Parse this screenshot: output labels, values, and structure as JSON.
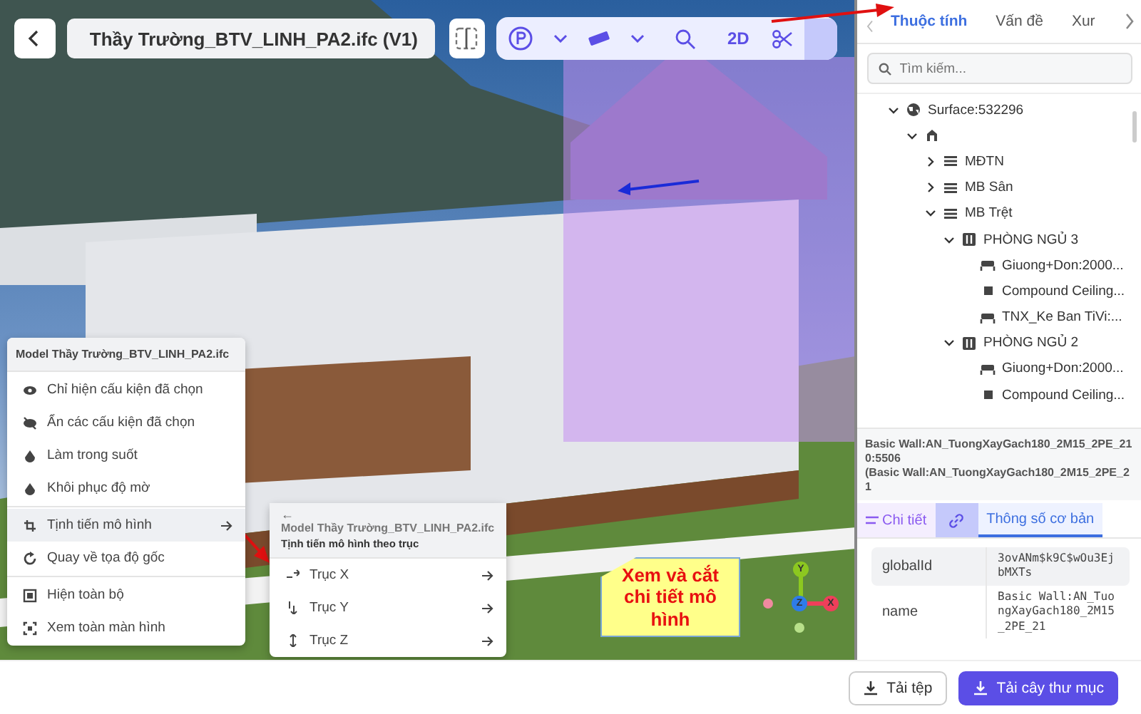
{
  "header": {
    "file_name": "Thầy Trường_BTV_LINH_PA2.ifc (V1)"
  },
  "toolbar": [
    {
      "kind": "pin",
      "selected": false
    },
    {
      "kind": "caret",
      "selected": false
    },
    {
      "kind": "ruler",
      "selected": false
    },
    {
      "kind": "caret",
      "selected": false
    },
    {
      "kind": "search",
      "selected": false
    },
    {
      "kind": "text",
      "label": "2D",
      "selected": false
    },
    {
      "kind": "scissors",
      "selected": false
    },
    {
      "kind": "tree",
      "selected": true
    }
  ],
  "context_menu": {
    "title": "Model Thầy Trường_BTV_LINH_PA2.ifc",
    "sections": [
      [
        {
          "kind": "eye",
          "label": "Chỉ hiện cấu kiện đã chọn",
          "selected": false,
          "submenu": false
        },
        {
          "kind": "eye-off",
          "label": "Ẩn các cấu kiện đã chọn",
          "selected": false,
          "submenu": false
        },
        {
          "kind": "drop",
          "label": "Làm trong suốt",
          "selected": false,
          "submenu": false
        },
        {
          "kind": "drop",
          "label": "Khôi phục độ mờ",
          "selected": false,
          "submenu": false
        }
      ],
      [
        {
          "kind": "move",
          "label": "Tịnh tiến mô hình",
          "selected": true,
          "submenu": true
        },
        {
          "kind": "rotate",
          "label": "Quay về tọa độ gốc",
          "selected": false,
          "submenu": false
        }
      ],
      [
        {
          "kind": "square",
          "label": "Hiện toàn bộ",
          "selected": false,
          "submenu": false
        },
        {
          "kind": "fullscreen",
          "label": "Xem toàn màn hình",
          "selected": false,
          "submenu": false
        }
      ]
    ]
  },
  "submenu": {
    "back": "←",
    "title": "Model Thầy Trường_BTV_LINH_PA2.ifc",
    "subtitle": "Tịnh tiến mô hình theo trục",
    "items": [
      {
        "kind": "x",
        "label": "Trục X"
      },
      {
        "kind": "y",
        "label": "Trục Y"
      },
      {
        "kind": "z",
        "label": "Trục Z"
      }
    ]
  },
  "callout": {
    "text": "Xem và cắt chi tiết mô hình"
  },
  "axis_gizmo": {
    "y": "Y",
    "z": "Z",
    "x": "X"
  },
  "panel": {
    "tabs": [
      {
        "label": "Thuộc tính",
        "selected": true
      },
      {
        "label": "Vấn đề",
        "selected": false
      },
      {
        "label": "Xur",
        "selected": false
      }
    ],
    "search": {
      "placeholder": "Tìm kiếm..."
    },
    "tree": [
      {
        "kind": "globe",
        "label": "Surface:532296",
        "expanded": true,
        "children": [
          {
            "kind": "building",
            "expanded": true,
            "children": [
              {
                "kind": "level",
                "label": "MĐTN",
                "expanded": false
              },
              {
                "kind": "level",
                "label": "MB Sân",
                "expanded": false
              },
              {
                "kind": "level",
                "label": "MB Trệt",
                "expanded": true,
                "children": [
                  {
                    "kind": "room",
                    "label": "PHÒNG NGỦ 3",
                    "expanded": true,
                    "children": [
                      {
                        "kind": "furniture",
                        "label": "Giuong+Don:2000..."
                      },
                      {
                        "kind": "element",
                        "label": "Compound Ceiling..."
                      },
                      {
                        "kind": "furniture",
                        "label": "TNX_Ke Ban TiVi:..."
                      }
                    ]
                  },
                  {
                    "kind": "room",
                    "label": "PHÒNG NGỦ 2",
                    "expanded": true,
                    "children": [
                      {
                        "kind": "furniture",
                        "label": "Giuong+Don:2000..."
                      },
                      {
                        "kind": "element",
                        "label": "Compound Ceiling..."
                      }
                    ]
                  }
                ]
              }
            ]
          }
        ]
      }
    ],
    "selection": {
      "name": "Basic Wall:AN_TuongXayGach180_2M15_2PE_210:5506",
      "type": "(Basic Wall:AN_TuongXayGach180_2M15_2PE_21"
    },
    "detail_tabs": [
      {
        "kind": "list",
        "label": "Chi tiết",
        "selected": false
      },
      {
        "kind": "link",
        "selected": false
      },
      {
        "kind": "text",
        "label": "Thông số cơ bản",
        "selected": true
      }
    ],
    "properties": [
      {
        "key": "globalId",
        "value": "3ovANm$k9C$wOu3EjbMXTs"
      },
      {
        "key": "name",
        "value": "Basic Wall:AN_TuongXayGach180_2M15_2PE_21"
      }
    ]
  },
  "footer": {
    "buttons": [
      {
        "label": "Tải tệp",
        "kind": "secondary"
      },
      {
        "label": "Tải cây thư mục",
        "kind": "primary"
      }
    ]
  }
}
